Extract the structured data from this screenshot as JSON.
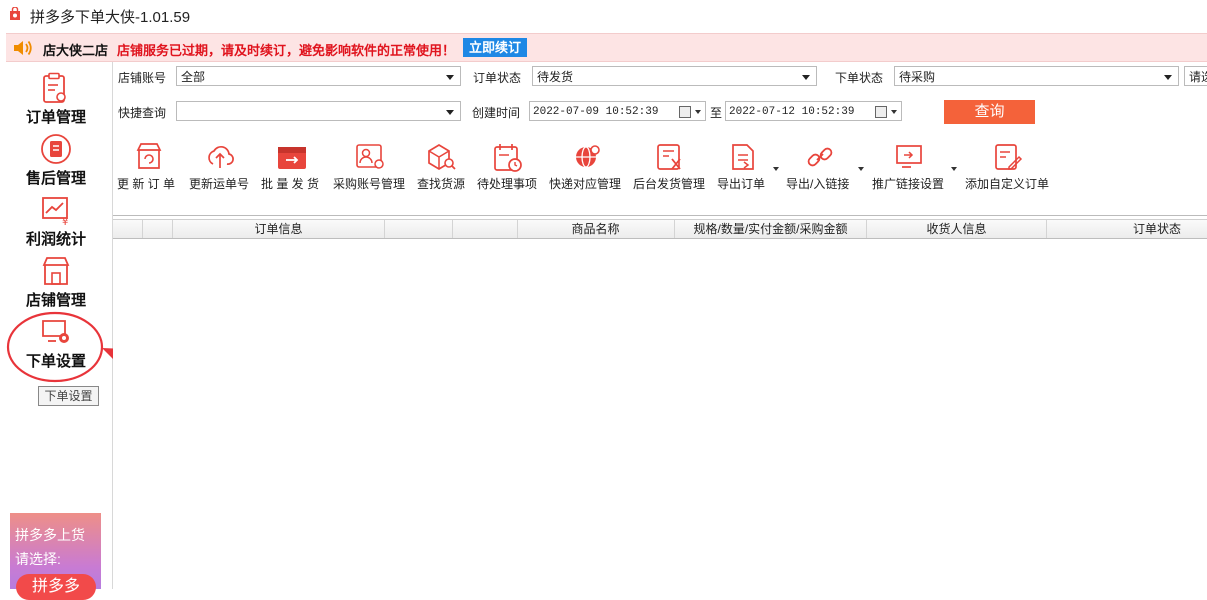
{
  "window": {
    "title": "拼多多下单大侠-1.01.59"
  },
  "notice": {
    "shop_name": "店大侠二店",
    "message": "店铺服务已过期，请及时续订，避免影响软件的正常使用！",
    "renew_label": "立即续订"
  },
  "sidebar": {
    "items": [
      {
        "label": "订单管理",
        "icon": "order-clipboard-icon"
      },
      {
        "label": "售后管理",
        "icon": "after-sale-icon"
      },
      {
        "label": "利润统计",
        "icon": "profit-chart-icon"
      },
      {
        "label": "店铺管理",
        "icon": "shop-icon"
      },
      {
        "label": "下单设置",
        "icon": "order-settings-icon"
      }
    ],
    "tooltip": "下单设置",
    "promo": {
      "line1": "拼多多上货",
      "line2": "请选择:",
      "pill": "拼多多"
    }
  },
  "filters": {
    "shop_account": {
      "label": "店铺账号",
      "value": "全部"
    },
    "order_status": {
      "label": "订单状态",
      "value": "待发货"
    },
    "purchase_status": {
      "label": "下单状态",
      "value": "待采购"
    },
    "extra": {
      "value": "请选"
    },
    "quick_query": {
      "label": "快捷查询",
      "value": ""
    },
    "created_time": {
      "label": "创建时间",
      "from": "2022-07-09 10:52:39",
      "to_label": "至",
      "to": "2022-07-12 10:52:39"
    },
    "query_label": "查询"
  },
  "toolbar": [
    {
      "label": "更 新 订 单",
      "icon": "update-order-icon"
    },
    {
      "label": "更新运单号",
      "icon": "update-waybill-icon"
    },
    {
      "label": "批 量 发 货",
      "icon": "batch-ship-icon"
    },
    {
      "label": "采购账号管理",
      "icon": "purchase-account-icon"
    },
    {
      "label": "查找货源",
      "icon": "find-source-icon"
    },
    {
      "label": "待处理事项",
      "icon": "pending-tasks-icon"
    },
    {
      "label": "快递对应管理",
      "icon": "courier-mapping-icon"
    },
    {
      "label": "后台发货管理",
      "icon": "backend-ship-icon"
    },
    {
      "label": "导出订单",
      "icon": "export-order-icon"
    },
    {
      "label": "导出/入链接",
      "icon": "link-icon"
    },
    {
      "label": "推广链接设置",
      "icon": "promo-link-settings-icon"
    },
    {
      "label": "添加自定义订单",
      "icon": "add-custom-order-icon"
    }
  ],
  "table": {
    "columns": [
      "订单信息",
      "商品名称",
      "规格/数量/实付金额/采购金额",
      "收货人信息",
      "订单状态"
    ]
  },
  "colors": {
    "accent": "#f4623a",
    "danger": "#e0141e",
    "renew": "#1e88e5"
  }
}
